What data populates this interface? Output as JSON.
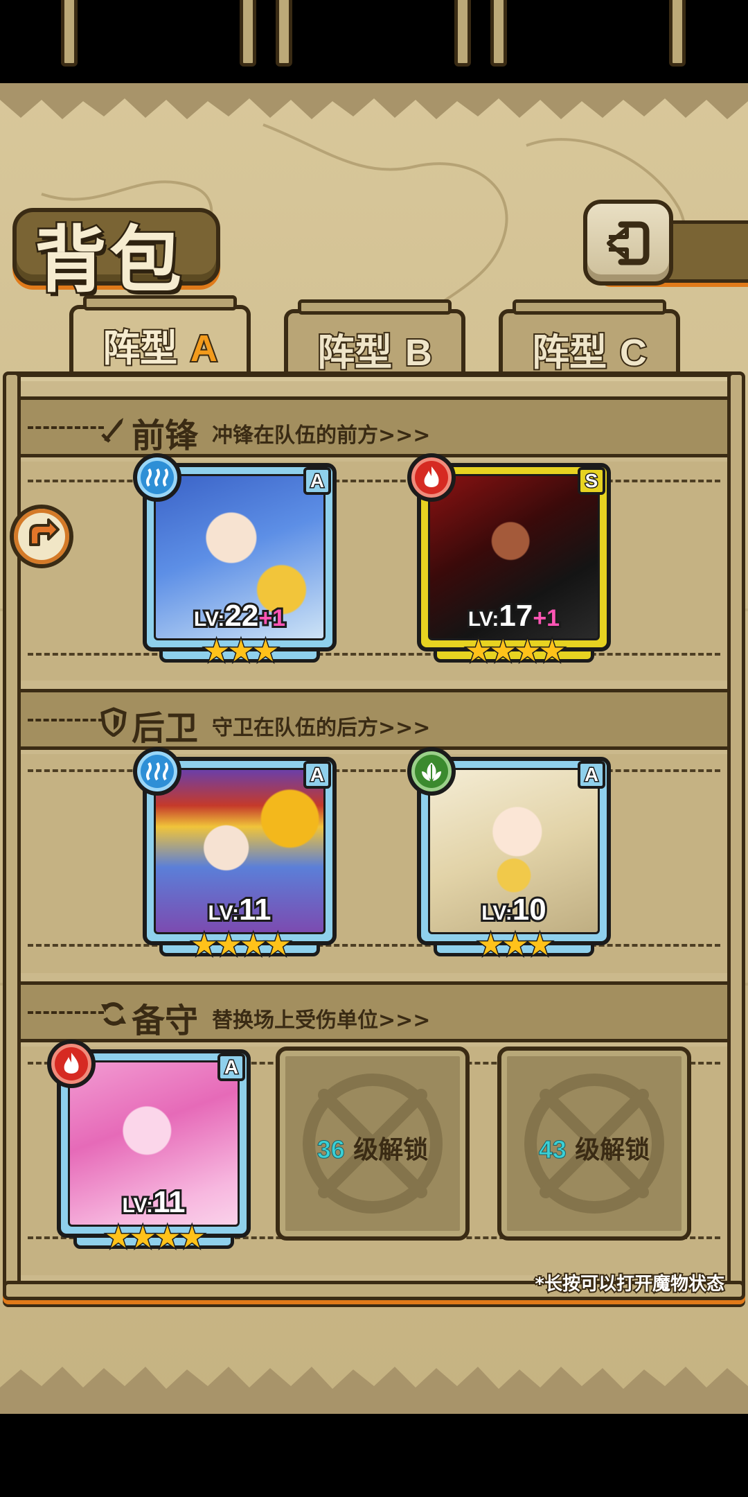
{
  "screen": {
    "title": "背包",
    "back_icon": "back-arrow-icon"
  },
  "tabs": [
    {
      "label": "阵型",
      "letter": "A",
      "active": true
    },
    {
      "label": "阵型",
      "letter": "B",
      "active": false
    },
    {
      "label": "阵型",
      "letter": "C",
      "active": false
    }
  ],
  "sections": {
    "front": {
      "title": "前锋",
      "desc": "冲锋在队伍的前方>>>",
      "icon": "sword-icon"
    },
    "back": {
      "title": "后卫",
      "desc": "守卫在队伍的后方>>>",
      "icon": "shield-icon"
    },
    "reserve": {
      "title": "备守",
      "desc": "替换场上受伤单位>>>",
      "icon": "swap-icon"
    }
  },
  "heroes": {
    "front": [
      {
        "element": "water",
        "rank": "A",
        "lv_prefix": "LV:",
        "level": "22",
        "bonus": "+1",
        "stars": 3
      },
      {
        "element": "fire",
        "rank": "S",
        "lv_prefix": "LV:",
        "level": "17",
        "bonus": "+1",
        "stars": 4
      }
    ],
    "back": [
      {
        "element": "water",
        "rank": "A",
        "lv_prefix": "LV:",
        "level": "11",
        "bonus": "",
        "stars": 4
      },
      {
        "element": "wood",
        "rank": "A",
        "lv_prefix": "LV:",
        "level": "10",
        "bonus": "",
        "stars": 3
      }
    ],
    "reserve": [
      {
        "element": "fire",
        "rank": "A",
        "lv_prefix": "LV:",
        "level": "11",
        "bonus": "",
        "stars": 4
      }
    ]
  },
  "locked_slots": [
    {
      "level": "36",
      "text": "级解锁"
    },
    {
      "level": "43",
      "text": "级解锁"
    }
  ],
  "stars_text": {
    "three": "★★★",
    "four": "★★★★"
  },
  "hint": "*长按可以打开魔物状态",
  "colors": {
    "accent": "#f39b1c",
    "water": "#2e8fd6",
    "fire": "#d62a22",
    "wood": "#3b8a2e",
    "gold_frame": "#e7d321",
    "blue_frame": "#8fd0ec"
  }
}
